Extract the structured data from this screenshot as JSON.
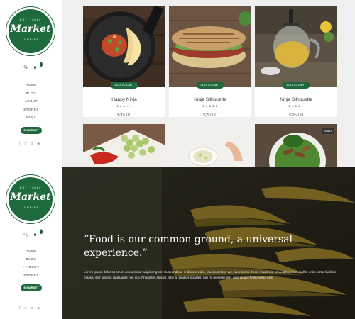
{
  "brand": {
    "est_left": "EST",
    "est_right": "2014",
    "name": "Market",
    "tagline": "JOBBIES"
  },
  "cart": {
    "count": "0"
  },
  "menu_top": [
    "HOME",
    "BLOG",
    "ABOUT",
    "STORES",
    "FAQS"
  ],
  "menu_bottom": [
    "HOME",
    "BLOG",
    "+ ABOUT",
    "STORES"
  ],
  "market_button": "E-MARKET",
  "products": [
    {
      "name": "Happy Ninja",
      "price": "$35.00",
      "add_label": "ADD TO CART",
      "rating": 3
    },
    {
      "name": "Ninja Silhouette",
      "price": "$20.00",
      "add_label": "ADD TO CART",
      "rating": 5
    },
    {
      "name": "Ninja Silhouette",
      "price": "$35.00",
      "add_label": "ADD TO CART",
      "rating": 4
    }
  ],
  "sold_badge": "SOLD",
  "hero": {
    "quote": "“Food is our common ground, a universal experience.”",
    "body": "Lorem ipsum dolor sit amet, consectetur adipiscing elit. Suspendisse in dui convallis, faucibus risus vel, viverra orci. Nunc maximus, urna id faucibus mollis, enim tortor facilisis massa, sed lobortis ligula ante nec nisi. Phasellus aliquet, nibh a dapibus sodales, nisi mi molestie nisl, quis iaculis felis massa sed."
  },
  "colors": {
    "accent": "#1e6a3c"
  },
  "icons": {
    "search": "search-icon",
    "cart": "cart-icon",
    "social": [
      "facebook-icon",
      "instagram-icon",
      "pinterest-icon",
      "twitter-icon"
    ]
  }
}
